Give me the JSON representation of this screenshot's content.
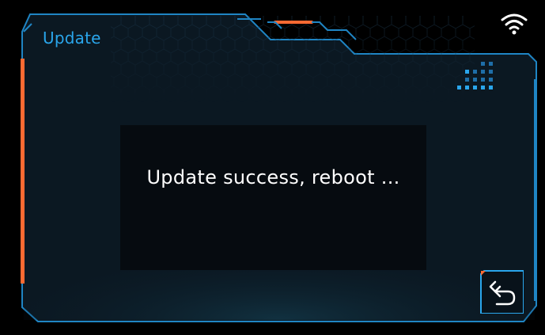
{
  "header": {
    "title": "Update"
  },
  "status": {
    "wifi_icon": "wifi-icon"
  },
  "dialog": {
    "message": "Update success, reboot ..."
  },
  "footer": {
    "back_icon": "back-arrow-icon"
  },
  "colors": {
    "accent_blue": "#2aa6ec",
    "accent_orange": "#ff6a32",
    "background": "#000000",
    "panel": "#0b1822"
  }
}
